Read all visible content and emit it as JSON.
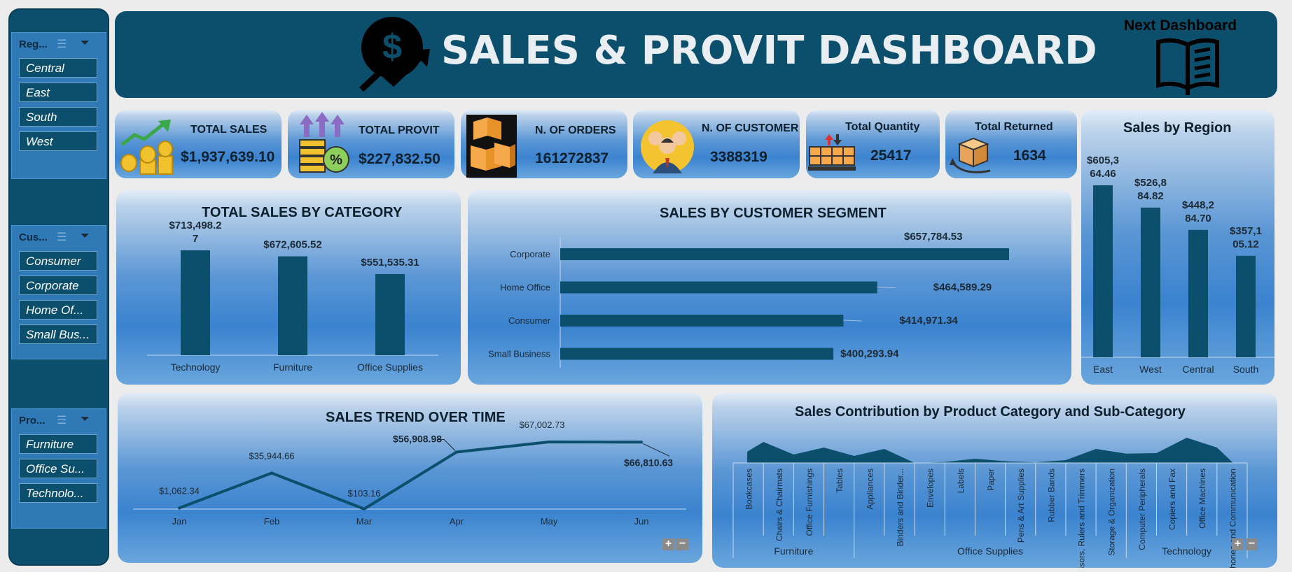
{
  "header": {
    "title": "SALES & PROVIT DASHBOARD",
    "next_label": "Next Dashboard"
  },
  "slicers": [
    {
      "title": "Reg...",
      "items": [
        "Central",
        "East",
        "South",
        "West"
      ]
    },
    {
      "title": "Cus...",
      "items": [
        "Consumer",
        "Corporate",
        "Home Of...",
        "Small Bus..."
      ]
    },
    {
      "title": "Pro...",
      "items": [
        "Furniture",
        "Office Su...",
        "Technolo..."
      ]
    }
  ],
  "kpis": {
    "total_sales": {
      "label": "TOTAL SALES",
      "value": "$1,937,639.10"
    },
    "total_provit": {
      "label": "TOTAL PROVIT",
      "value": "$227,832.50"
    },
    "orders": {
      "label": "N. OF ORDERS",
      "value": "161272837"
    },
    "customers": {
      "label": "N. OF CUSTOMER",
      "value": "3388319"
    },
    "quantity": {
      "label": "Total Quantity",
      "value": "25417"
    },
    "returned": {
      "label": "Total Returned",
      "value": "1634"
    }
  },
  "icons": [
    "sales-growth-icon",
    "profit-coins-icon",
    "boxes-icon",
    "customers-icon",
    "quantity-pallet-icon",
    "returned-box-icon",
    "dollar-trend-icon",
    "book-icon",
    "filter-clear-icon",
    "multi-select-icon",
    "zoom-plus-icon",
    "zoom-minus-icon"
  ],
  "colors": {
    "bar": "#0b4f6c",
    "header": "#0b4f6c",
    "panel": "#3b83cf"
  },
  "chart_data": [
    {
      "id": "category",
      "type": "bar",
      "title": "TOTAL SALES BY CATEGORY",
      "categories": [
        "Technology",
        "Furniture",
        "Office Supplies"
      ],
      "values": [
        713498.27,
        672605.52,
        551535.31
      ],
      "labels": [
        [
          "$713,498.2",
          "7"
        ],
        [
          "$672,605.52"
        ],
        [
          "$551,535.31"
        ]
      ]
    },
    {
      "id": "segment",
      "type": "bar",
      "orientation": "horizontal",
      "title": "SALES BY CUSTOMER SEGMENT",
      "categories": [
        "Corporate",
        "Home Office",
        "Consumer",
        "Small Business"
      ],
      "values": [
        657784.53,
        464589.29,
        414971.34,
        400293.94
      ],
      "labels": [
        "$657,784.53",
        "$464,589.29",
        "$414,971.34",
        "$400,293.94"
      ]
    },
    {
      "id": "region",
      "type": "bar",
      "title": "Sales by Region",
      "categories": [
        "East",
        "West",
        "Central",
        "South"
      ],
      "values": [
        605364.46,
        526884.82,
        448284.7,
        357105.12
      ],
      "labels": [
        [
          "$605,3",
          "64.46"
        ],
        [
          "$526,8",
          "84.82"
        ],
        [
          "$448,2",
          "84.70"
        ],
        [
          "$357,1",
          "05.12"
        ]
      ]
    },
    {
      "id": "trend",
      "type": "line",
      "title": "SALES TREND OVER TIME",
      "categories": [
        "Jan",
        "Feb",
        "Mar",
        "Apr",
        "May",
        "Jun"
      ],
      "values": [
        1062.34,
        35944.66,
        103.16,
        56908.98,
        67002.73,
        66810.63
      ],
      "labels": [
        "$1,062.34",
        "$35,944.66",
        "$103.16",
        "$56,908.98",
        "$67,002.73",
        "$66,810.63"
      ]
    },
    {
      "id": "contribution",
      "type": "area",
      "title": "Sales Contribution by Product Category and Sub-Category",
      "groups": [
        {
          "name": "Furniture",
          "subs": [
            "Bookcases",
            "Chairs & Chairmats",
            "Office Furnishings",
            "Tables"
          ]
        },
        {
          "name": "Office Supplies",
          "subs": [
            "Appliances",
            "Binders and Binder...",
            "Envelopes",
            "Labels",
            "Paper",
            "Pens & Art Supplies",
            "Rubber Bands",
            "Scissors, Rulers and Trimmers",
            "Storage & Organization"
          ]
        },
        {
          "name": "Technology",
          "subs": [
            "Computer Peripherals",
            "Copiers and Fax",
            "Office Machines",
            "Telephones and Communication"
          ]
        }
      ],
      "values": [
        0.4,
        0.75,
        0.3,
        0.55,
        0.25,
        0.5,
        0.0,
        0.03,
        0.15,
        0.06,
        0.02,
        0.1,
        0.5,
        0.33,
        0.35,
        0.9,
        0.55
      ]
    }
  ]
}
